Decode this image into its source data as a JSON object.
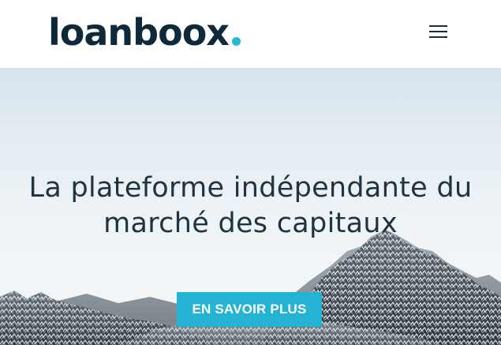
{
  "header": {
    "logo_text": "loanboox",
    "menu_icon": "hamburger-menu-icon"
  },
  "hero": {
    "title_line_1": "La plateforme indépendante du",
    "title_line_2": "marché des capitaux",
    "cta_label": "EN SAVOIR PLUS",
    "background_image": "snowy-mountains-image"
  },
  "colors": {
    "brand_dark": "#0e2a3a",
    "accent": "#25b3d4",
    "title_text": "#1f3340",
    "sky": "#dce7ee"
  }
}
